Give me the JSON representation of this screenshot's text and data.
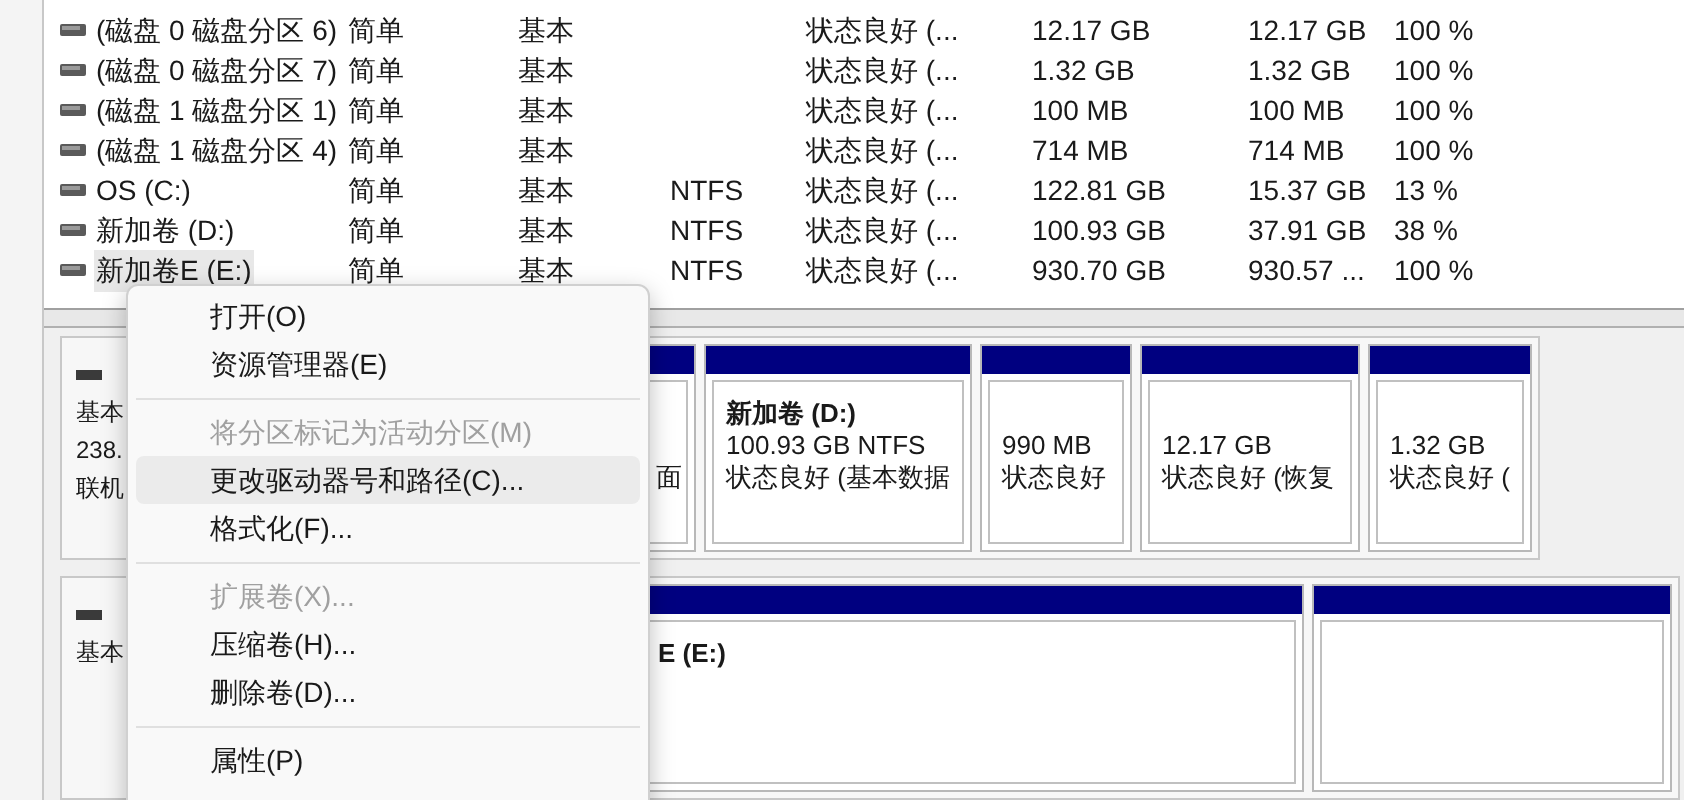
{
  "volume_table": {
    "rows": [
      {
        "name": "(磁盘 0 磁盘分区 6)",
        "layout": "简单",
        "type": "基本",
        "status": "状态良好 (...",
        "capacity": "12.17 GB",
        "free": "12.17 GB",
        "percent_free": "100 %",
        "selected": false
      },
      {
        "name": "(磁盘 0 磁盘分区 7)",
        "layout": "简单",
        "type": "基本",
        "status": "状态良好 (...",
        "capacity": "1.32 GB",
        "free": "1.32 GB",
        "percent_free": "100 %",
        "selected": false
      },
      {
        "name": "(磁盘 1 磁盘分区 1)",
        "layout": "简单",
        "type": "基本",
        "status": "状态良好 (...",
        "capacity": "100 MB",
        "free": "100 MB",
        "percent_free": "100 %",
        "selected": false
      },
      {
        "name": "(磁盘 1 磁盘分区 4)",
        "layout": "简单",
        "type": "基本",
        "status": "状态良好 (...",
        "capacity": "714 MB",
        "free": "714 MB",
        "percent_free": "100 %",
        "selected": false
      },
      {
        "name": "OS (C:)",
        "layout": "简单",
        "type": "基本",
        "file_system": "NTFS",
        "status": "状态良好 (...",
        "capacity": "122.81 GB",
        "free": "15.37 GB",
        "percent_free": "13 %",
        "selected": false
      },
      {
        "name": "新加卷 (D:)",
        "layout": "简单",
        "type": "基本",
        "file_system": "NTFS",
        "status": "状态良好 (...",
        "capacity": "100.93 GB",
        "free": "37.91 GB",
        "percent_free": "38 %",
        "selected": false
      },
      {
        "name": "新加卷E (E:)",
        "layout": "简单",
        "type": "基本",
        "file_system": "NTFS",
        "status": "状态良好 (...",
        "capacity": "930.70 GB",
        "free": "930.57 ...",
        "percent_free": "100 %",
        "selected": true
      }
    ]
  },
  "disks": [
    {
      "label": [
        "基本",
        "238.",
        "联机"
      ],
      "partitions": [
        {
          "kind": "volume",
          "status": "面"
        },
        {
          "kind": "volume",
          "name": "新加卷 (D:)",
          "size": "100.93 GB NTFS",
          "status": "状态良好 (基本数据"
        },
        {
          "kind": "volume",
          "size": "990 MB",
          "status": "状态良好"
        },
        {
          "kind": "volume",
          "size": "12.17 GB",
          "status": "状态良好 (恢复"
        },
        {
          "kind": "volume",
          "size": "1.32 GB",
          "status": "状态良好 ("
        }
      ]
    },
    {
      "label": [
        "基本"
      ],
      "partitions": [
        {
          "kind": "volume",
          "name": "E  (E:)"
        },
        {
          "kind": "volume"
        }
      ]
    }
  ],
  "context_menu": [
    {
      "kind": "item",
      "label": "打开(O)",
      "disabled": false,
      "selected": false
    },
    {
      "kind": "item",
      "label": "资源管理器(E)",
      "disabled": false,
      "selected": false
    },
    {
      "kind": "separator"
    },
    {
      "kind": "item",
      "label": "将分区标记为活动分区(M)",
      "disabled": true,
      "selected": false
    },
    {
      "kind": "item",
      "label": "更改驱动器号和路径(C)...",
      "disabled": false,
      "selected": true
    },
    {
      "kind": "item",
      "label": "格式化(F)...",
      "disabled": false,
      "selected": false
    },
    {
      "kind": "separator"
    },
    {
      "kind": "item",
      "label": "扩展卷(X)...",
      "disabled": true,
      "selected": false
    },
    {
      "kind": "item",
      "label": "压缩卷(H)...",
      "disabled": false,
      "selected": false
    },
    {
      "kind": "item",
      "label": "删除卷(D)...",
      "disabled": false,
      "selected": false
    },
    {
      "kind": "separator"
    },
    {
      "kind": "item",
      "label": "属性(P)",
      "disabled": false,
      "selected": false
    }
  ]
}
